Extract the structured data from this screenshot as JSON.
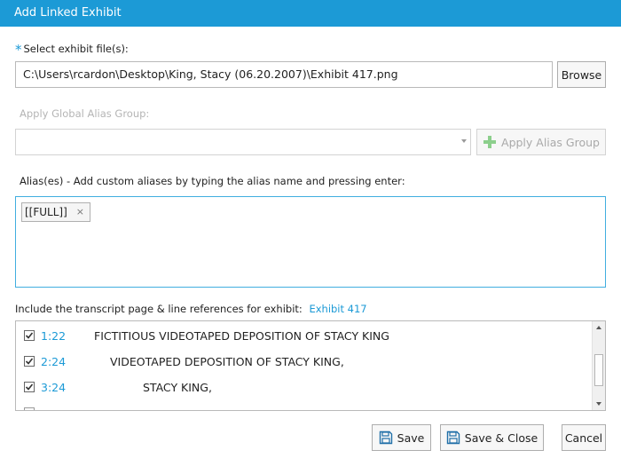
{
  "window": {
    "title": "Add Linked Exhibit"
  },
  "file_select": {
    "label": "Select exhibit file(s):",
    "required_mark": "*",
    "value": "C:\\Users\\rcardon\\Desktop\\King, Stacy (06.20.2007)\\Exhibit 417.png",
    "browse_label": "Browse"
  },
  "alias_group": {
    "label": "Apply Global Alias Group:",
    "selected": "",
    "apply_label": "Apply Alias Group"
  },
  "aliases": {
    "label": "Alias(es) - Add custom aliases by typing the alias name and pressing enter:",
    "tags": [
      {
        "text": "[[FULL]]",
        "remove": "×"
      }
    ]
  },
  "references": {
    "label": "Include the transcript page & line references for exhibit:",
    "exhibit_link": "Exhibit 417",
    "rows": [
      {
        "ref": "1:22",
        "text": "FICTITIOUS VIDEOTAPED DEPOSITION OF STACY KING",
        "checked": true
      },
      {
        "ref": "2:24",
        "text": "VIDEOTAPED DEPOSITION OF STACY KING,",
        "checked": true
      },
      {
        "ref": "3:24",
        "text": "STACY KING,",
        "checked": true
      }
    ]
  },
  "footer": {
    "save_label": "Save",
    "save_close_label": "Save & Close",
    "cancel_label": "Cancel"
  },
  "colors": {
    "accent": "#1c9ad6",
    "titlebar": "#1c9ad6",
    "link": "#1c9ad6"
  },
  "icons": {
    "save": "floppy-disk-icon",
    "add": "plus-icon",
    "dropdown": "chevron-down-icon"
  }
}
